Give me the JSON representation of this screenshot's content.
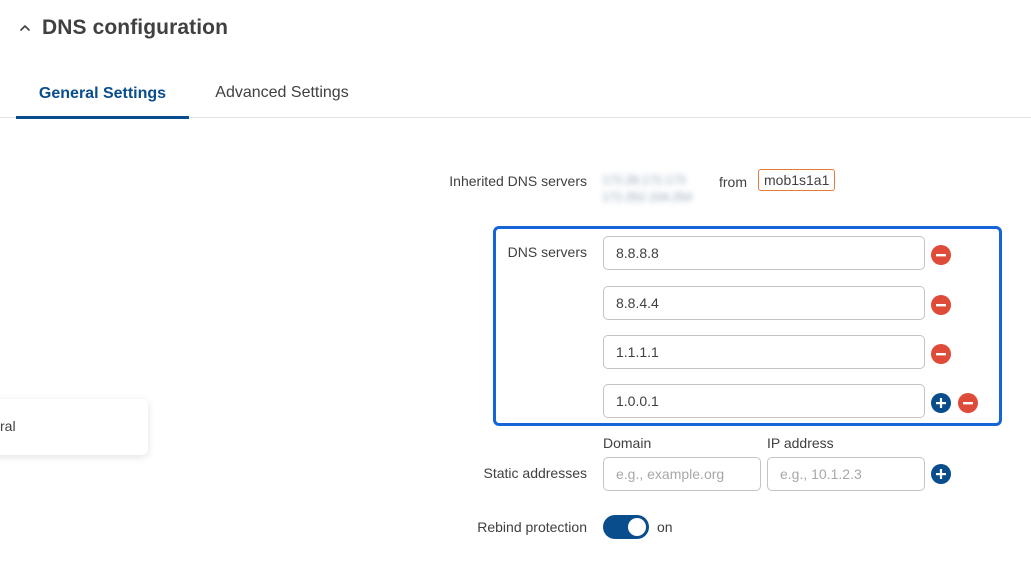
{
  "section": {
    "title": "DNS configuration"
  },
  "tabs": [
    {
      "label": "General Settings",
      "active": true
    },
    {
      "label": "Advanced Settings",
      "active": false
    }
  ],
  "inherited": {
    "label": "Inherited DNS servers",
    "from_text": "from",
    "interface": "mob1s1a1",
    "ips": [
      "172.28.172.173",
      "172.252.104.254"
    ]
  },
  "dns_servers": {
    "label": "DNS servers",
    "values": [
      "8.8.8.8",
      "8.8.4.4",
      "1.1.1.1",
      "1.0.0.1"
    ]
  },
  "static_addresses": {
    "label": "Static addresses",
    "domain_header": "Domain",
    "ip_header": "IP address",
    "domain_placeholder": "e.g., example.org",
    "ip_placeholder": "e.g., 10.1.2.3"
  },
  "rebind": {
    "label": "Rebind protection",
    "state_text": "on",
    "enabled": true
  },
  "floating_card": {
    "text": "ral"
  },
  "colors": {
    "accent": "#0a4d8c",
    "highlight": "#1565d8",
    "remove": "#de4b39",
    "badge_border": "#e07b39"
  },
  "icons": {
    "collapse": "chevron-up-icon",
    "remove": "minus-circle-icon",
    "add": "plus-circle-icon"
  }
}
